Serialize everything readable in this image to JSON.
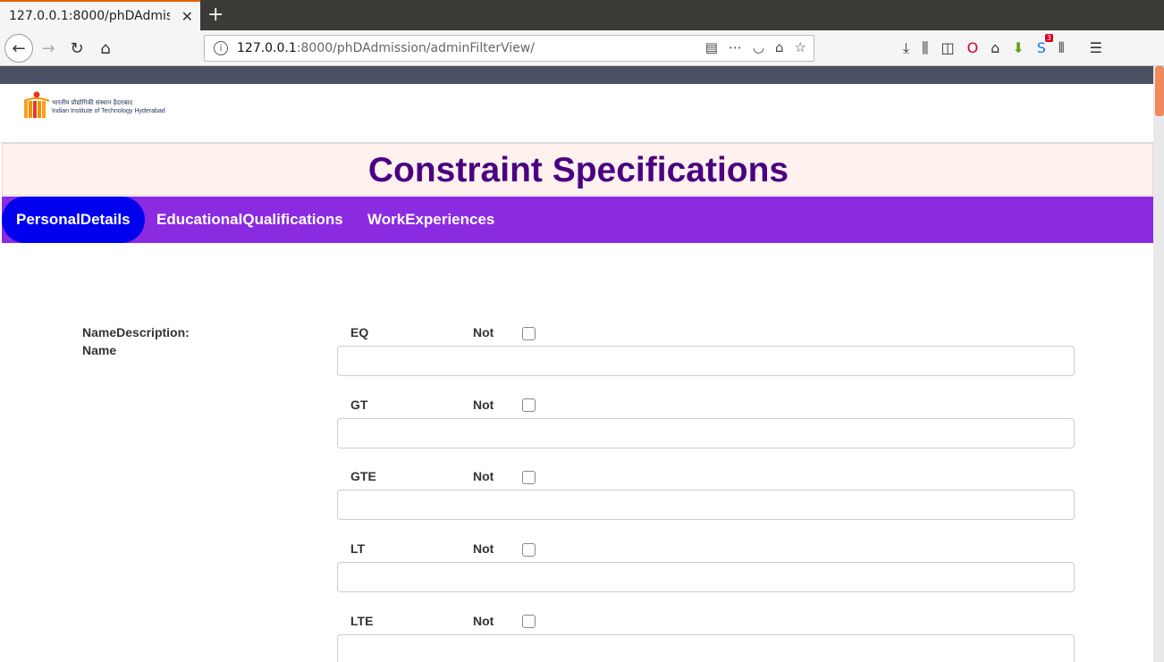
{
  "browser": {
    "tab_title": "127.0.0.1:8000/phDAdmissi",
    "url_host": "127.0.0.1",
    "url_rest": ":8000/phDAdmission/adminFilterView/",
    "notification_count": "3"
  },
  "logo": {
    "hindi": "भारतीय प्रौद्योगिकी संस्थान हैदराबाद",
    "english": "Indian Institute of Technology Hyderabad"
  },
  "page": {
    "title": "Constraint Specifications"
  },
  "tabs": [
    {
      "label": "PersonalDetails"
    },
    {
      "label": "EducationalQualifications"
    },
    {
      "label": "WorkExperiences"
    }
  ],
  "form": {
    "field_label": "NameDescription:",
    "field_sublabel": "Name",
    "not_label": "Not",
    "rows": [
      {
        "op": "EQ"
      },
      {
        "op": "GT"
      },
      {
        "op": "GTE"
      },
      {
        "op": "LT"
      },
      {
        "op": "LTE"
      }
    ]
  },
  "colors": {
    "title": "#4b0082",
    "nav": "#8a2be2",
    "active_tab": "#0000ee"
  }
}
